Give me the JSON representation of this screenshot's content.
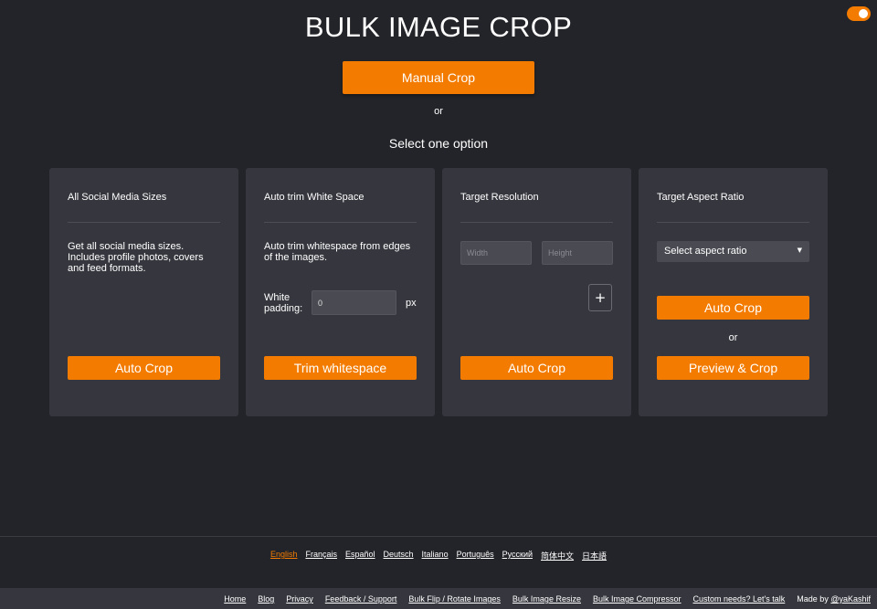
{
  "header": {
    "title": "BULK IMAGE CROP",
    "manual_crop_label": "Manual Crop",
    "or_label": "or",
    "select_label": "Select one option"
  },
  "cards": {
    "social": {
      "title": "All Social Media Sizes",
      "description": "Get all social media sizes. Includes profile photos, covers and feed formats.",
      "button": "Auto Crop"
    },
    "trim": {
      "title": "Auto trim White Space",
      "description": "Auto trim whitespace from edges of the images.",
      "padding_label": "White padding:",
      "padding_value": "0",
      "unit": "px",
      "button": "Trim whitespace"
    },
    "resolution": {
      "title": "Target Resolution",
      "width_placeholder": "Width",
      "height_placeholder": "Height",
      "plus": "+",
      "button": "Auto Crop"
    },
    "aspect": {
      "title": "Target Aspect Ratio",
      "select_value": "Select aspect ratio",
      "select_arrow": "▼",
      "button_auto": "Auto Crop",
      "or_label": "or",
      "button_preview": "Preview & Crop"
    }
  },
  "languages": [
    "English",
    "Français",
    "Español",
    "Deutsch",
    "Italiano",
    "Português",
    "Русский",
    "简体中文",
    "日本語"
  ],
  "footer": {
    "links": [
      "Home",
      "Blog",
      "Privacy",
      "Feedback / Support",
      "Bulk Flip / Rotate Images",
      "Bulk Image Resize",
      "Bulk Image Compressor",
      "Custom needs? Let's talk"
    ],
    "made_by": "Made by",
    "author": "@yaKashif"
  },
  "colors": {
    "accent": "#f27b00",
    "background": "#232429",
    "card": "#36373e"
  }
}
